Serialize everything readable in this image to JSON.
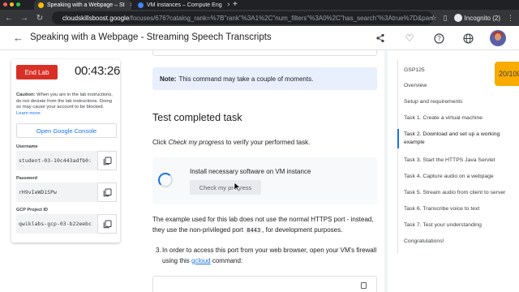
{
  "browser": {
    "tabs": [
      {
        "title": "Speaking with a Webpage – St",
        "active": true
      },
      {
        "title": "VM instances – Compute Eng",
        "active": false
      }
    ],
    "url_host": "cloudskillsboost.google",
    "url_path": "/focuses/676?catalog_rank=%7B\"rank\"%3A1%2C\"num_filters\"%3A0%2C\"has_search\"%3Atrue%7D&parent=cat...",
    "profile_label": "Incognito (2)"
  },
  "header": {
    "title": "Speaking with a Webpage - Streaming Speech Transcripts"
  },
  "lab_panel": {
    "end_lab_label": "End Lab",
    "timer": "00:43:26",
    "caution_bold": "Caution:",
    "caution_text": " When you are in the lab instructions, do not deviate from the lab instructions. Doing so may cause your account to be blocked.",
    "learn_more": "Learn more.",
    "open_console_label": "Open Google Console",
    "username_label": "Username",
    "username_value": "student-03-10c443adfb0:",
    "password_label": "Password",
    "password_value": "rH9vIeWD1SPw",
    "project_label": "GCP Project ID",
    "project_value": "qwiklabs-gcp-03-b22eebc"
  },
  "main": {
    "note_bold": "Note:",
    "note_text": "This command may take a couple of moments.",
    "heading": "Test completed task",
    "instruction_pre": "Click ",
    "instruction_em": "Check my progress",
    "instruction_post": " to verify your performed task.",
    "check_title": "Install necessary software on VM instance",
    "check_button": "Check my progress",
    "para1_line1": "The example used for this lab does not use the normal HTTPS port - instead,",
    "para1_pre": "they use the non-privileged port ",
    "para1_code": "8443",
    "para1_post": ", for development purposes.",
    "step3_num": "3.",
    "step3_line1": "In order to access this port from your web browser, open your VM's firewall",
    "step3_pre": "using this ",
    "step3_link": "gcloud",
    "step3_post": " command:"
  },
  "toc": {
    "items": [
      "GSP125",
      "Overview",
      "Setup and requirements",
      "Task 1. Create a virtual machine",
      "Task 2. Download and set up a working example",
      "Task 3. Start the HTTPS Java Servlet",
      "Task 4. Capture audio on a webpage",
      "Task 5. Stream audio from client to server",
      "Task 6. Transcribe voice to text",
      "Task 7. Test your understanding",
      "Congratulations!"
    ],
    "active_index": 4
  },
  "score": "20/100",
  "colors": {
    "accent": "#1a73e8",
    "end_lab": "#d93025",
    "score": "#f9ab00",
    "note_bg": "#e8f0fe"
  }
}
